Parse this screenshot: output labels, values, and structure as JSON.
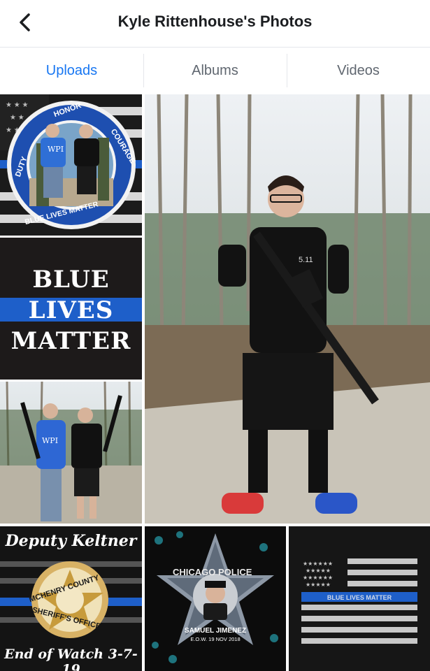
{
  "header": {
    "title": "Kyle Rittenhouse's Photos",
    "back_icon": "chevron-left-icon"
  },
  "tabs": [
    {
      "label": "Uploads",
      "active": true
    },
    {
      "label": "Albums",
      "active": false
    },
    {
      "label": "Videos",
      "active": false
    }
  ],
  "photos": {
    "badge": {
      "ring_top": "HONOR",
      "ring_left": "DUTY",
      "ring_right": "COURAGE",
      "ring_bottom": "BLUE LIVES MATTER",
      "shirt_logo": "WPI"
    },
    "blm_card": {
      "line1": "BLUE",
      "line2": "LIVES",
      "line3": "MATTER"
    },
    "duo_photo": {
      "shirt_logo": "WPI"
    },
    "main_photo": {
      "shirt_text": "5.11"
    },
    "deputy": {
      "name": "Deputy Keltner",
      "county": "MCHENRY COUNTY",
      "office": "SHERIFF'S OFFICE",
      "eow": "End of Watch 3-7-19"
    },
    "chicago": {
      "star_text": "CHICAGO POLICE",
      "name": "SAMUEL JIMENEZ",
      "eow": "E.O.W. 19 NOV 2018"
    },
    "flag": {
      "stripe_text": "BLUE LIVES MATTER"
    }
  },
  "colors": {
    "accent": "#1877f2",
    "police_blue": "#1e5fc9"
  }
}
